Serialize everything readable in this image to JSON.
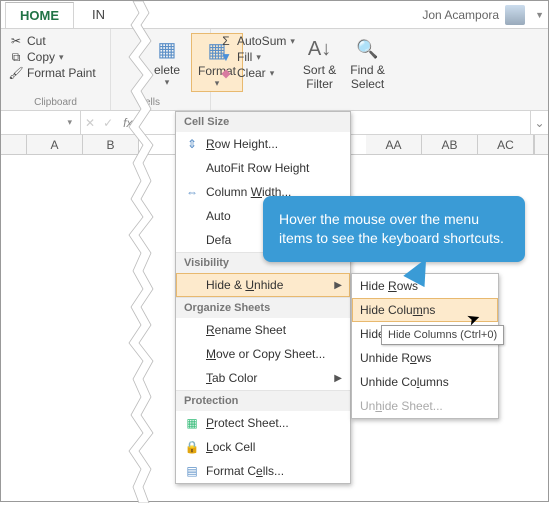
{
  "titlebar": {
    "tabs": [
      "HOME",
      "IN"
    ],
    "user": "Jon Acampora"
  },
  "ribbon": {
    "clipboard": {
      "cut": "Cut",
      "copy": "Copy",
      "paint": "Format Paint",
      "group": "Clipboard"
    },
    "cells_frag": {
      "delete": "elete",
      "format": "Format",
      "group": "ells"
    },
    "editing": {
      "autosum": "AutoSum",
      "fill": "Fill",
      "clear": "Clear",
      "sort": "Sort &\nFilter",
      "find": "Find &\nSelect"
    }
  },
  "columns": [
    "A",
    "B",
    "AA",
    "AB",
    "AC"
  ],
  "menu": {
    "cell_size": "Cell Size",
    "row_height": "Row Height...",
    "autofit_row": "AutoFit Row Height",
    "col_width": "Column Width...",
    "autofit_col_frag": "Auto",
    "default_frag": "Defa",
    "visibility": "Visibility",
    "hide_unhide": "Hide & Unhide",
    "organize": "Organize Sheets",
    "rename": "Rename Sheet",
    "move_copy": "Move or Copy Sheet...",
    "tab_color": "Tab Color",
    "protection": "Protection",
    "protect": "Protect Sheet...",
    "lock": "Lock Cell",
    "format_cells": "Format Cells..."
  },
  "submenu": {
    "hide_rows": "Hide Rows",
    "hide_cols": "Hide Columns",
    "hide_sheet_frag": "Hide S",
    "unhide_rows": "Unhide Rows",
    "unhide_cols": "Unhide Columns",
    "unhide_sheet": "Unhide Sheet..."
  },
  "tooltip": "Hide Columns (Ctrl+0)",
  "callout": "Hover the mouse over the menu items to see the keyboard shortcuts."
}
